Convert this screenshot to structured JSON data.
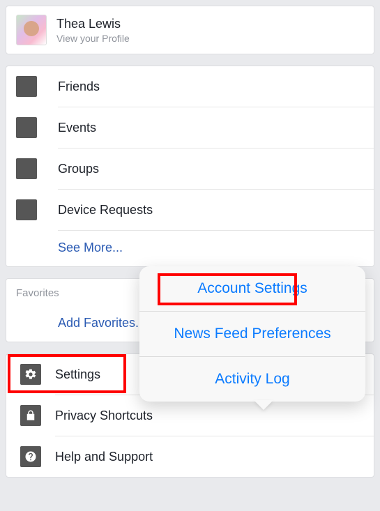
{
  "profile": {
    "name": "Thea Lewis",
    "sub": "View your Profile"
  },
  "main_menu": {
    "items": [
      {
        "label": "Friends"
      },
      {
        "label": "Events"
      },
      {
        "label": "Groups"
      },
      {
        "label": "Device Requests"
      }
    ],
    "see_more": "See More..."
  },
  "favorites": {
    "header": "Favorites",
    "add": "Add Favorites..."
  },
  "settings_menu": {
    "items": [
      {
        "label": "Settings",
        "icon": "gear"
      },
      {
        "label": "Privacy Shortcuts",
        "icon": "lock"
      },
      {
        "label": "Help and Support",
        "icon": "help"
      }
    ]
  },
  "popover": {
    "items": [
      "Account Settings",
      "News Feed Preferences",
      "Activity Log"
    ]
  }
}
